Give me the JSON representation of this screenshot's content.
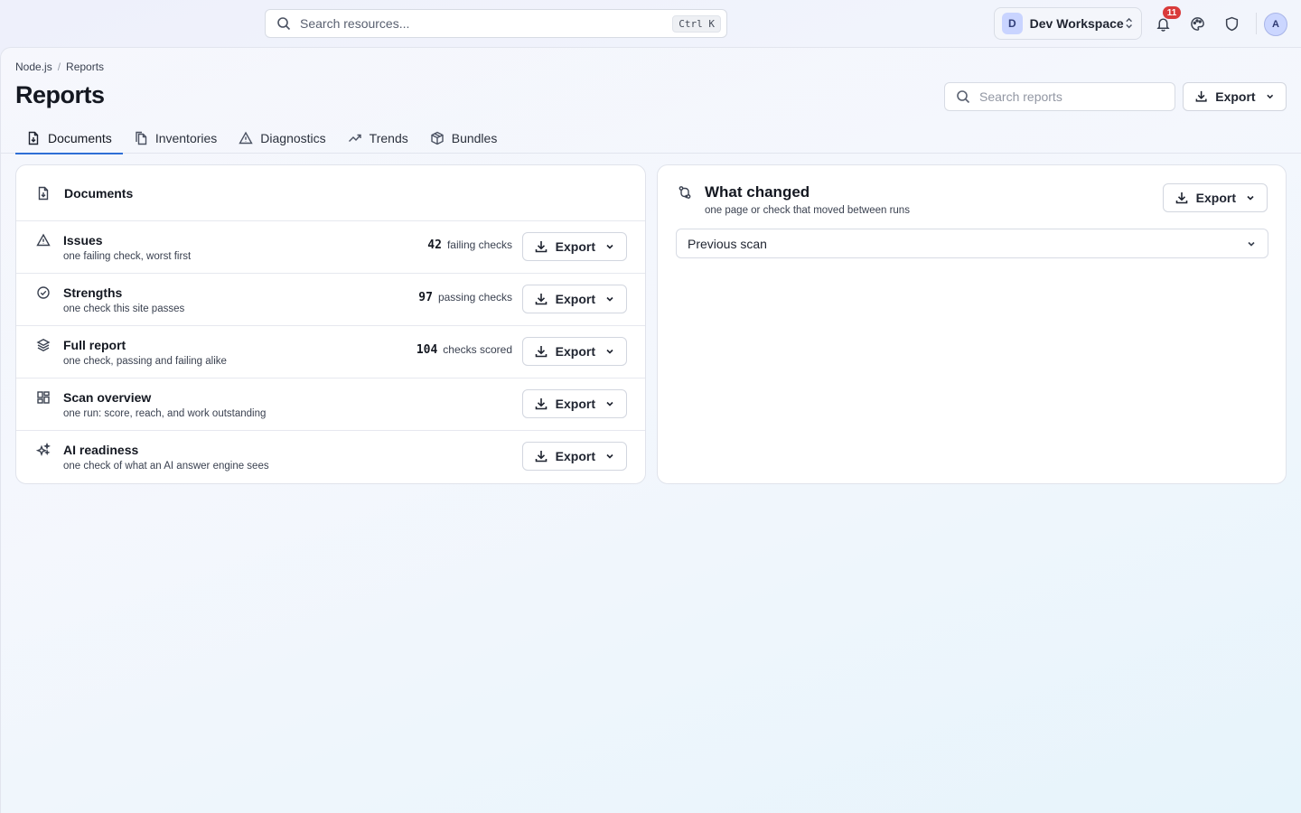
{
  "topbar": {
    "search_placeholder": "Search resources...",
    "search_shortcut": "Ctrl K",
    "workspace_initial": "D",
    "workspace_name": "Dev Workspace",
    "notification_count": "11",
    "user_initial": "A"
  },
  "breadcrumb": [
    "Node.js",
    "Reports"
  ],
  "page_title": "Reports",
  "reports_search_placeholder": "Search reports",
  "export_label": "Export",
  "tabs": [
    {
      "label": "Documents",
      "icon": "file-download-icon",
      "active": true
    },
    {
      "label": "Inventories",
      "icon": "files-icon",
      "active": false
    },
    {
      "label": "Diagnostics",
      "icon": "warning-triangle-icon",
      "active": false
    },
    {
      "label": "Trends",
      "icon": "trend-up-icon",
      "active": false
    },
    {
      "label": "Bundles",
      "icon": "package-icon",
      "active": false
    }
  ],
  "documents": {
    "title": "Documents",
    "rows": [
      {
        "title": "Issues",
        "subtitle": "one failing check, worst first",
        "count": "42",
        "count_label": "failing checks",
        "icon": "warning-triangle-icon"
      },
      {
        "title": "Strengths",
        "subtitle": "one check this site passes",
        "count": "97",
        "count_label": "passing checks",
        "icon": "check-circle-icon"
      },
      {
        "title": "Full report",
        "subtitle": "one check, passing and failing alike",
        "count": "104",
        "count_label": "checks scored",
        "icon": "layers-icon"
      },
      {
        "title": "Scan overview",
        "subtitle": "one run: score, reach, and work outstanding",
        "icon": "dashboard-grid-icon"
      },
      {
        "title": "AI readiness",
        "subtitle": "one check of what an AI answer engine sees",
        "icon": "sparkles-icon"
      }
    ]
  },
  "changes": {
    "title": "What changed",
    "subtitle": "one page or check that moved between runs",
    "select_value": "Previous scan"
  },
  "colors": {
    "accent": "#2f6fd6",
    "badge": "#d93a3a"
  }
}
